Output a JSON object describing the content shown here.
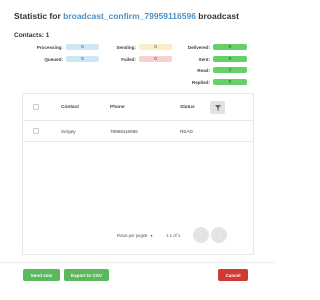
{
  "title": {
    "prefix": "Statistic for",
    "name": "broadcast_confirm_79959116596",
    "suffix": "broadcast"
  },
  "contacts": "Contacts: 1",
  "stats": {
    "processing": {
      "label": "Processing:",
      "value": "0"
    },
    "queued": {
      "label": "Queued:",
      "value": "0"
    },
    "sending": {
      "label": "Sending:",
      "value": "0"
    },
    "failed": {
      "label": "Failed:",
      "value": "0"
    },
    "delivered": {
      "label": "Delivered:",
      "value": "0"
    },
    "sent": {
      "label": "Sent:",
      "value": "0"
    },
    "read": {
      "label": "Read:",
      "value": "1"
    },
    "replied": {
      "label": "Replied:",
      "value": "0"
    }
  },
  "table": {
    "headers": {
      "contact": "Contact",
      "phone": "Phone",
      "status": "Status"
    },
    "rows": [
      {
        "contact": "Sergey",
        "phone": "79959116596",
        "status": "READ"
      }
    ]
  },
  "pagination": {
    "rows_per_page_label": "Rows per page",
    "rows_per_page_value": "5",
    "range": "1-1 of 1"
  },
  "buttons": {
    "send_sms": "Send sms",
    "export_csv": "Export to CSV",
    "cancel": "Cancel"
  },
  "colors": {
    "link": "#4a90c8",
    "green": "#5cb85c",
    "red": "#d03a32",
    "stat_green": "#63d06a"
  }
}
